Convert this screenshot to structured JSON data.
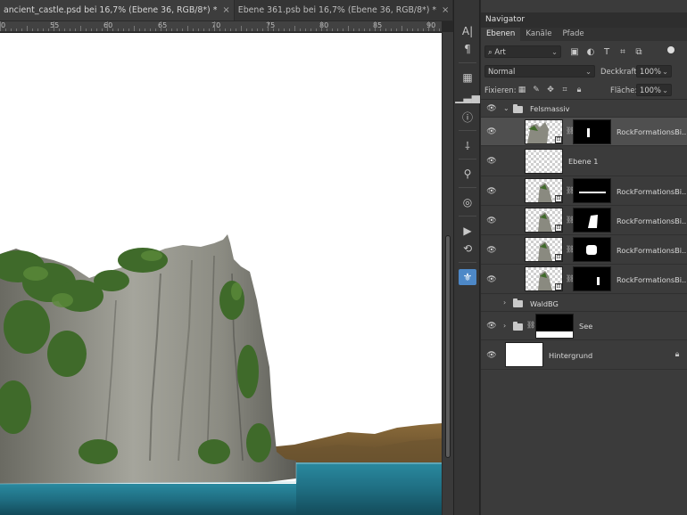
{
  "document_tabs": [
    {
      "label": "ancient_castle.psd bei 16,7% (Ebene 36, RGB/8*) *",
      "active": true
    },
    {
      "label": "Ebene 361.psb bei 16,7% (Ebene 36, RGB/8*) *",
      "active": false
    }
  ],
  "ruler": {
    "labels": [
      "0",
      "55",
      "60",
      "65",
      "70",
      "75",
      "80",
      "85",
      "90"
    ]
  },
  "panels": {
    "navigator_title": "Navigator",
    "tabs": [
      "Ebenen",
      "Kanäle",
      "Pfade"
    ]
  },
  "layers_panel": {
    "filter_kind": "Art",
    "blend_mode": "Normal",
    "opacity_label": "Deckkraft:",
    "opacity_value": "100%",
    "lock_label": "Fixieren:",
    "fill_label": "Fläche:",
    "fill_value": "100%"
  },
  "layers": [
    {
      "name": "Felsmassiv",
      "type": "group",
      "expanded": true
    },
    {
      "name": "RockFormationsBi...",
      "type": "smart",
      "selected": true
    },
    {
      "name": "Ebene 1",
      "type": "pixel"
    },
    {
      "name": "RockFormationsBi...",
      "type": "smart"
    },
    {
      "name": "RockFormationsBi...",
      "type": "smart"
    },
    {
      "name": "RockFormationsBi...",
      "type": "smart"
    },
    {
      "name": "RockFormationsBi...",
      "type": "smart"
    },
    {
      "name": "WaldBG",
      "type": "group",
      "expanded": false
    },
    {
      "name": "See",
      "type": "group-masked",
      "expanded": false
    },
    {
      "name": "Hintergrund",
      "type": "background",
      "locked": true
    }
  ],
  "colors": {
    "accent": "#4d88c7",
    "panel": "#3b3b3b",
    "selected_layer": "#4f4f4f"
  },
  "tool_icons": [
    "character-panel-icon",
    "paragraph-icon",
    "swatches-icon",
    "histogram-icon",
    "info-icon",
    "brush-settings-icon",
    "clone-source-icon",
    "cc-libraries-icon",
    "play-action-icon",
    "history-icon",
    "properties-icon"
  ]
}
